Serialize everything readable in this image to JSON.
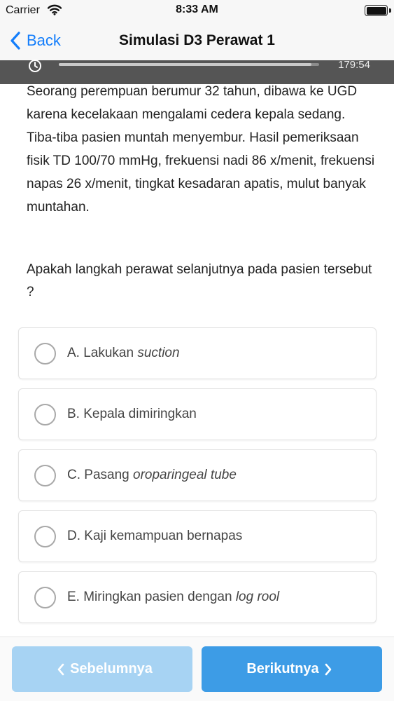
{
  "status_bar": {
    "carrier": "Carrier",
    "time": "8:33 AM"
  },
  "nav": {
    "back_label": "Back",
    "title": "Simulasi D3 Perawat 1"
  },
  "timer": {
    "remaining": "179:54",
    "progress_fraction": 0.97
  },
  "question": {
    "stem": "Seorang perempuan berumur 32 tahun, dibawa ke UGD karena kecelakaan mengalami cedera kepala sedang. Tiba-tiba pasien muntah menyembur. Hasil pemeriksaan fisik TD 100/70 mmHg, frekuensi nadi 86 x/menit, frekuensi napas 26 x/menit, tingkat kesadaran apatis, mulut banyak muntahan.",
    "prompt": "Apakah langkah perawat selanjutnya pada pasien tersebut ?"
  },
  "options": [
    {
      "prefix": "A. Lakukan ",
      "italic": "suction",
      "suffix": ""
    },
    {
      "prefix": "B. Kepala dimiringkan",
      "italic": "",
      "suffix": ""
    },
    {
      "prefix": "C. Pasang ",
      "italic": "oroparingeal tube",
      "suffix": ""
    },
    {
      "prefix": "D. Kaji kemampuan bernapas",
      "italic": "",
      "suffix": ""
    },
    {
      "prefix": "E. Miringkan pasien dengan ",
      "italic": "log rool",
      "suffix": ""
    }
  ],
  "footer": {
    "prev_label": "Sebelumnya",
    "next_label": "Berikutnya"
  },
  "colors": {
    "accent": "#147efb",
    "button_next": "#3d9ce6",
    "button_prev_disabled": "#a7d3f3",
    "timer_bar": "#555555"
  },
  "icons": {
    "wifi": "wifi-icon",
    "back": "chevron-left-icon",
    "timer": "stopwatch-icon",
    "prev": "chevron-left-icon",
    "next": "chevron-right-icon"
  }
}
